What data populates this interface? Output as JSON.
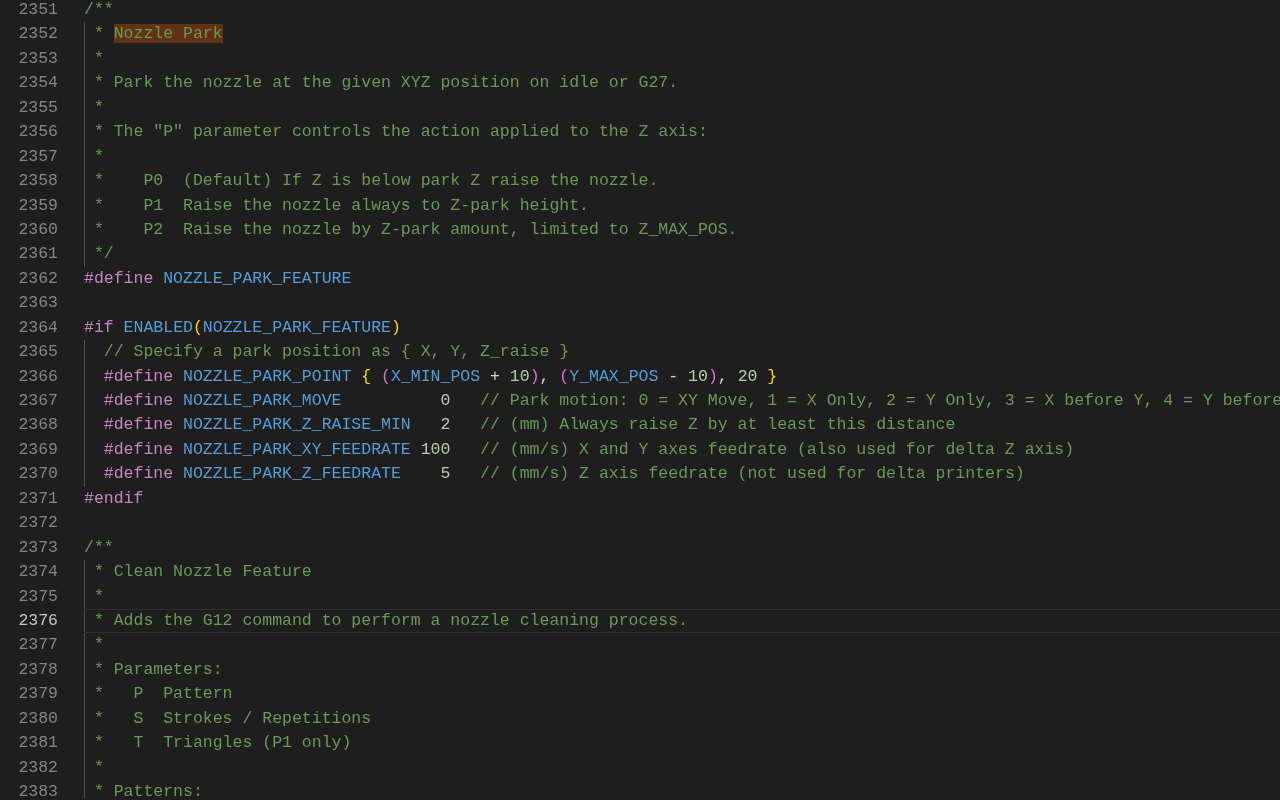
{
  "editor": {
    "lines": [
      {
        "number": "2351",
        "guide": false,
        "current": false,
        "tokens": [
          {
            "kind": "comment",
            "text": "/**"
          }
        ]
      },
      {
        "number": "2352",
        "guide": true,
        "current": false,
        "tokens": [
          {
            "kind": "comment",
            "text": " * "
          },
          {
            "kind": "highlight",
            "text": "Nozzle Park"
          }
        ]
      },
      {
        "number": "2353",
        "guide": true,
        "current": false,
        "tokens": [
          {
            "kind": "comment",
            "text": " *"
          }
        ]
      },
      {
        "number": "2354",
        "guide": true,
        "current": false,
        "tokens": [
          {
            "kind": "comment",
            "text": " * Park the nozzle at the given XYZ position on idle or G27."
          }
        ]
      },
      {
        "number": "2355",
        "guide": true,
        "current": false,
        "tokens": [
          {
            "kind": "comment",
            "text": " *"
          }
        ]
      },
      {
        "number": "2356",
        "guide": true,
        "current": false,
        "tokens": [
          {
            "kind": "comment",
            "text": " * The \"P\" parameter controls the action applied to the Z axis:"
          }
        ]
      },
      {
        "number": "2357",
        "guide": true,
        "current": false,
        "tokens": [
          {
            "kind": "comment",
            "text": " *"
          }
        ]
      },
      {
        "number": "2358",
        "guide": true,
        "current": false,
        "tokens": [
          {
            "kind": "comment",
            "text": " *    P0  (Default) If Z is below park Z raise the nozzle."
          }
        ]
      },
      {
        "number": "2359",
        "guide": true,
        "current": false,
        "tokens": [
          {
            "kind": "comment",
            "text": " *    P1  Raise the nozzle always to Z-park height."
          }
        ]
      },
      {
        "number": "2360",
        "guide": true,
        "current": false,
        "tokens": [
          {
            "kind": "comment",
            "text": " *    P2  Raise the nozzle by Z-park amount, limited to Z_MAX_POS."
          }
        ]
      },
      {
        "number": "2361",
        "guide": true,
        "current": false,
        "tokens": [
          {
            "kind": "comment",
            "text": " */"
          }
        ]
      },
      {
        "number": "2362",
        "guide": false,
        "current": false,
        "tokens": [
          {
            "kind": "keyword",
            "text": "#define"
          },
          {
            "kind": "macro",
            "text": " NOZZLE_PARK_FEATURE"
          }
        ]
      },
      {
        "number": "2363",
        "guide": false,
        "current": false
      },
      {
        "number": "2364",
        "guide": false,
        "current": false,
        "tokens": [
          {
            "kind": "keyword",
            "text": "#if"
          },
          {
            "kind": "macro",
            "text": " ENABLED"
          },
          {
            "kind": "bracket1",
            "text": "("
          },
          {
            "kind": "macro",
            "text": "NOZZLE_PARK_FEATURE"
          },
          {
            "kind": "bracket1",
            "text": ")"
          }
        ]
      },
      {
        "number": "2365",
        "guide": true,
        "current": false,
        "tokens": [
          {
            "kind": "comment",
            "text": "  // Specify a park position as { X, Y, Z_raise }"
          }
        ]
      },
      {
        "number": "2366",
        "guide": true,
        "current": false,
        "tokens": [
          {
            "kind": "keyword",
            "text": "  #define"
          },
          {
            "kind": "macro",
            "text": " NOZZLE_PARK_POINT"
          },
          {
            "kind": "bracket1",
            "text": " {"
          },
          {
            "kind": "bracket2",
            "text": " ("
          },
          {
            "kind": "macro",
            "text": "X_MIN_POS"
          },
          {
            "kind": "plain",
            "text": " + "
          },
          {
            "kind": "number",
            "text": "10"
          },
          {
            "kind": "bracket2",
            "text": ")"
          },
          {
            "kind": "plain",
            "text": ", "
          },
          {
            "kind": "bracket2",
            "text": "("
          },
          {
            "kind": "macro",
            "text": "Y_MAX_POS"
          },
          {
            "kind": "plain",
            "text": " - "
          },
          {
            "kind": "number",
            "text": "10"
          },
          {
            "kind": "bracket2",
            "text": ")"
          },
          {
            "kind": "plain",
            "text": ", "
          },
          {
            "kind": "number",
            "text": "20"
          },
          {
            "kind": "bracket1",
            "text": " }"
          }
        ]
      },
      {
        "number": "2367",
        "guide": true,
        "current": false,
        "tokens": [
          {
            "kind": "keyword",
            "text": "  #define"
          },
          {
            "kind": "macro",
            "text": " NOZZLE_PARK_MOVE"
          },
          {
            "kind": "number",
            "text": "          0"
          },
          {
            "kind": "comment",
            "text": "   // Park motion: 0 = XY Move, 1 = X Only, 2 = Y Only, 3 = X before Y, 4 = Y before"
          }
        ]
      },
      {
        "number": "2368",
        "guide": true,
        "current": false,
        "tokens": [
          {
            "kind": "keyword",
            "text": "  #define"
          },
          {
            "kind": "macro",
            "text": " NOZZLE_PARK_Z_RAISE_MIN"
          },
          {
            "kind": "number",
            "text": "   2"
          },
          {
            "kind": "comment",
            "text": "   // (mm) Always raise Z by at least this distance"
          }
        ]
      },
      {
        "number": "2369",
        "guide": true,
        "current": false,
        "tokens": [
          {
            "kind": "keyword",
            "text": "  #define"
          },
          {
            "kind": "macro",
            "text": " NOZZLE_PARK_XY_FEEDRATE"
          },
          {
            "kind": "number",
            "text": " 100"
          },
          {
            "kind": "comment",
            "text": "   // (mm/s) X and Y axes feedrate (also used for delta Z axis)"
          }
        ]
      },
      {
        "number": "2370",
        "guide": true,
        "current": false,
        "tokens": [
          {
            "kind": "keyword",
            "text": "  #define"
          },
          {
            "kind": "macro",
            "text": " NOZZLE_PARK_Z_FEEDRATE"
          },
          {
            "kind": "number",
            "text": "    5"
          },
          {
            "kind": "comment",
            "text": "   // (mm/s) Z axis feedrate (not used for delta printers)"
          }
        ]
      },
      {
        "number": "2371",
        "guide": false,
        "current": false,
        "tokens": [
          {
            "kind": "keyword",
            "text": "#endif"
          }
        ]
      },
      {
        "number": "2372",
        "guide": false,
        "current": false
      },
      {
        "number": "2373",
        "guide": false,
        "current": false,
        "tokens": [
          {
            "kind": "comment",
            "text": "/**"
          }
        ]
      },
      {
        "number": "2374",
        "guide": true,
        "current": false,
        "tokens": [
          {
            "kind": "comment",
            "text": " * Clean Nozzle Feature"
          }
        ]
      },
      {
        "number": "2375",
        "guide": true,
        "current": false,
        "tokens": [
          {
            "kind": "comment",
            "text": " *"
          }
        ]
      },
      {
        "number": "2376",
        "guide": true,
        "current": true,
        "tokens": [
          {
            "kind": "comment",
            "text": " * Adds the G12 command to perform a nozzle cleaning process."
          }
        ]
      },
      {
        "number": "2377",
        "guide": true,
        "current": false,
        "tokens": [
          {
            "kind": "comment",
            "text": " *"
          }
        ]
      },
      {
        "number": "2378",
        "guide": true,
        "current": false,
        "tokens": [
          {
            "kind": "comment",
            "text": " * Parameters:"
          }
        ]
      },
      {
        "number": "2379",
        "guide": true,
        "current": false,
        "tokens": [
          {
            "kind": "comment",
            "text": " *   P  Pattern"
          }
        ]
      },
      {
        "number": "2380",
        "guide": true,
        "current": false,
        "tokens": [
          {
            "kind": "comment",
            "text": " *   S  Strokes / Repetitions"
          }
        ]
      },
      {
        "number": "2381",
        "guide": true,
        "current": false,
        "tokens": [
          {
            "kind": "comment",
            "text": " *   T  Triangles (P1 only)"
          }
        ]
      },
      {
        "number": "2382",
        "guide": true,
        "current": false,
        "tokens": [
          {
            "kind": "comment",
            "text": " *"
          }
        ]
      },
      {
        "number": "2383",
        "guide": true,
        "current": false,
        "tokens": [
          {
            "kind": "comment",
            "text": " * Patterns:"
          }
        ]
      }
    ]
  }
}
